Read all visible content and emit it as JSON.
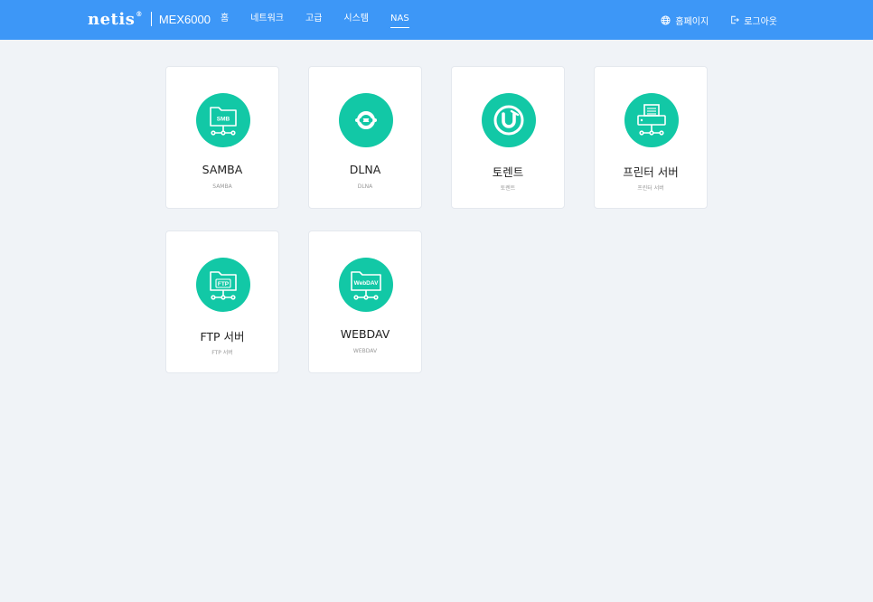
{
  "header": {
    "logo": "netis",
    "logo_mark": "®",
    "model": "MEX6000",
    "nav": [
      {
        "label": "홈",
        "active": false
      },
      {
        "label": "네트워크",
        "active": false
      },
      {
        "label": "고급",
        "active": false
      },
      {
        "label": "시스템",
        "active": false
      },
      {
        "label": "NAS",
        "active": true
      }
    ],
    "homepage_label": "홈페이지",
    "homepage_icon": "globe-icon",
    "logout_label": "로그아웃",
    "logout_icon": "logout-icon",
    "accent_color": "#3d97f7"
  },
  "cards": [
    {
      "title": "SAMBA",
      "subtitle": "SAMBA",
      "icon": "smb-folder-icon",
      "badge": "SMB"
    },
    {
      "title": "DLNA",
      "subtitle": "DLNA",
      "icon": "dlna-icon"
    },
    {
      "title": "토렌트",
      "subtitle": "토렌트",
      "icon": "torrent-icon"
    },
    {
      "title": "프린터 서버",
      "subtitle": "프린터 서버",
      "icon": "printer-icon"
    },
    {
      "title": "FTP 서버",
      "subtitle": "FTP 서버",
      "icon": "ftp-folder-icon",
      "badge": "FTP"
    },
    {
      "title": "WEBDAV",
      "subtitle": "WEBDAV",
      "icon": "webdav-folder-icon",
      "badge": "WebDAV"
    }
  ],
  "icon_color": "#12c8a6"
}
